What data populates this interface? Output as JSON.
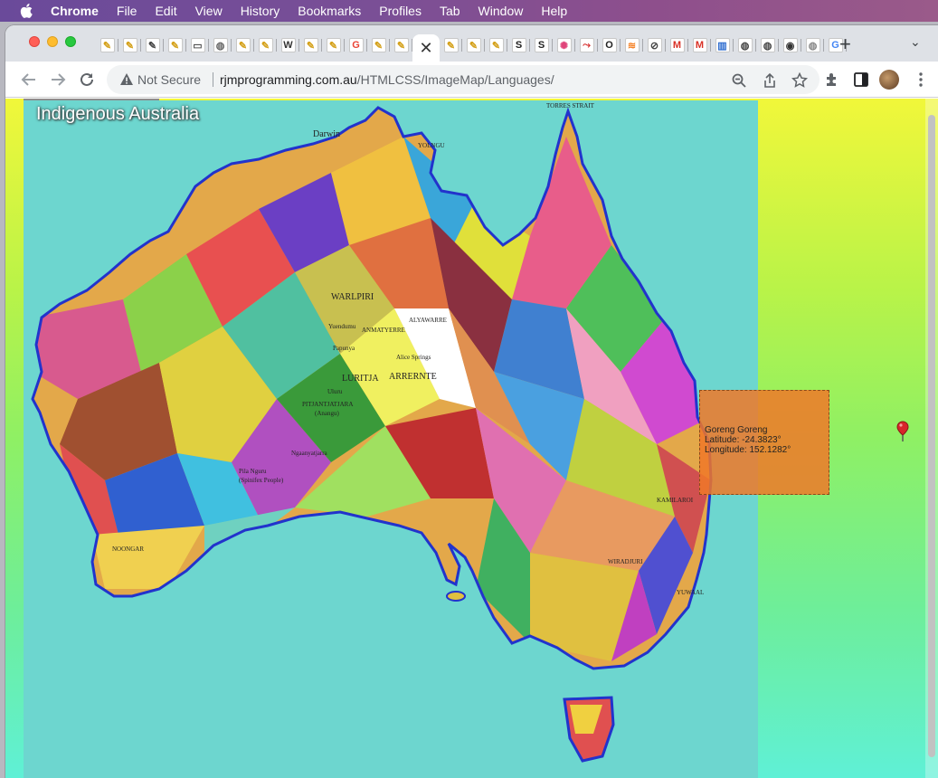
{
  "menubar": {
    "app": "Chrome",
    "items": [
      "File",
      "Edit",
      "View",
      "History",
      "Bookmarks",
      "Profiles",
      "Tab",
      "Window",
      "Help"
    ]
  },
  "tabs": {
    "favicons": [
      {
        "name": "pen-icon",
        "color": "#d4a018",
        "glyph": "✎"
      },
      {
        "name": "pen-icon",
        "color": "#d4a018",
        "glyph": "✎"
      },
      {
        "name": "pen-icon",
        "color": "#444444",
        "glyph": "✎"
      },
      {
        "name": "pen-icon",
        "color": "#d4a018",
        "glyph": "✎"
      },
      {
        "name": "document-icon",
        "color": "#555555",
        "glyph": "▭"
      },
      {
        "name": "globe-icon",
        "color": "#666666",
        "glyph": "◍"
      },
      {
        "name": "pen-icon",
        "color": "#d4a018",
        "glyph": "✎"
      },
      {
        "name": "pen-icon",
        "color": "#d4a018",
        "glyph": "✎"
      },
      {
        "name": "wikipedia-icon",
        "color": "#333333",
        "glyph": "W"
      },
      {
        "name": "pen-icon",
        "color": "#d4a018",
        "glyph": "✎"
      },
      {
        "name": "pen-icon",
        "color": "#d4a018",
        "glyph": "✎"
      },
      {
        "name": "google-icon",
        "color": "#ea4335",
        "glyph": "G"
      },
      {
        "name": "pen-icon",
        "color": "#d4a018",
        "glyph": "✎"
      },
      {
        "name": "pen-icon",
        "color": "#d4a018",
        "glyph": "✎"
      }
    ],
    "active_close": "✕",
    "favicons_after": [
      {
        "name": "pen-icon",
        "color": "#d4a018",
        "glyph": "✎"
      },
      {
        "name": "pen-icon",
        "color": "#d4a018",
        "glyph": "✎"
      },
      {
        "name": "pen-icon",
        "color": "#d4a018",
        "glyph": "✎"
      },
      {
        "name": "s-app-icon",
        "color": "#222222",
        "glyph": "S"
      },
      {
        "name": "s-app-icon",
        "color": "#222222",
        "glyph": "S"
      },
      {
        "name": "spinner-icon",
        "color": "#e0457b",
        "glyph": "✺"
      },
      {
        "name": "arrow-app-icon",
        "color": "#d52b2b",
        "glyph": "⤳"
      },
      {
        "name": "o-app-icon",
        "color": "#222222",
        "glyph": "O"
      },
      {
        "name": "stack-icon",
        "color": "#f48024",
        "glyph": "≋"
      },
      {
        "name": "link-icon",
        "color": "#444444",
        "glyph": "⊘"
      },
      {
        "name": "gmail-icon",
        "color": "#d93025",
        "glyph": "M"
      },
      {
        "name": "gmail-icon",
        "color": "#d93025",
        "glyph": "M"
      },
      {
        "name": "books-icon",
        "color": "#2d6ccf",
        "glyph": "▥"
      },
      {
        "name": "globe-icon",
        "color": "#444444",
        "glyph": "◍"
      },
      {
        "name": "globe-icon",
        "color": "#444444",
        "glyph": "◍"
      },
      {
        "name": "github-icon",
        "color": "#333333",
        "glyph": "◉"
      },
      {
        "name": "globe-icon",
        "color": "#888888",
        "glyph": "◍"
      },
      {
        "name": "google-icon",
        "color": "#4285f4",
        "glyph": "G"
      }
    ],
    "new_tab": "+",
    "tab_menu": "⌄"
  },
  "toolbar": {
    "security_label": "Not Secure",
    "url_host": "rjmprogramming.com.au",
    "url_path": "/HTMLCSS/ImageMap/Languages/"
  },
  "page": {
    "map_title": "Indigenous Australia",
    "labels": {
      "torres_strait": "TORRES STRAIT",
      "yolngu": "YOLNGU",
      "darwin": "Darwin",
      "warlpiri": "WARLPIRI",
      "yuendumu": "Yuendumu",
      "anmatyerre": "ANMATYERRE",
      "alyawarre": "ALYAWARRE",
      "papunya": "Papunya",
      "alice_springs": "Alice Springs",
      "luritja": "LURITJA",
      "arrernte": "ARRERNTE",
      "uluru": "Uluru",
      "pitjantjatjara": "PITJANTJATJARA",
      "anangu": "(Anangu)",
      "ngaanyatjarra": "Ngaanyatjarra",
      "pila_nguru": "Pila Nguru",
      "spinifex": "(Spinifex People)",
      "noongar": "NOONGAR",
      "wiradjuri": "WIRADJURI",
      "kamilaroi": "KAMILAROI",
      "yuwaal": "YUWAAL"
    },
    "tooltip": {
      "name": "Goreng Goreng",
      "latitude": "Latitude: -24.3823°",
      "longitude": "Longitude: 152.1282°"
    }
  },
  "colors": {
    "map_ocean": "#6dd6cf",
    "map_border": "#2233cc",
    "tooltip_fill": "#f07828",
    "pin": "#d8262b"
  }
}
